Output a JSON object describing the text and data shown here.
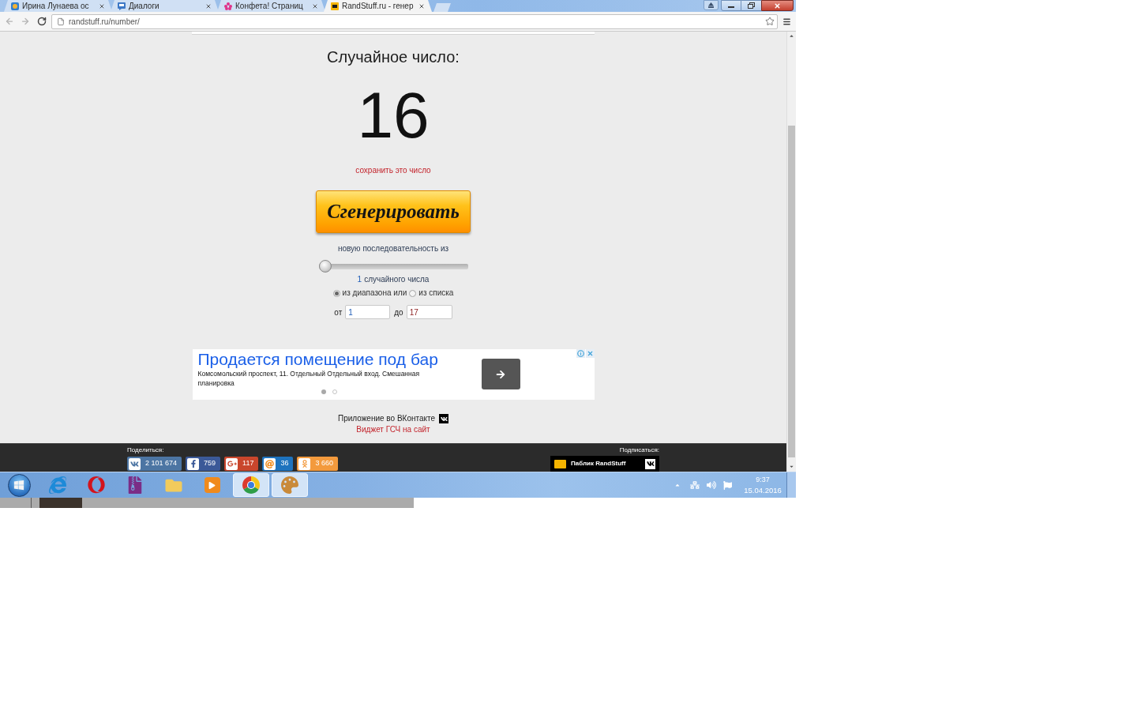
{
  "browser": {
    "tabs": [
      {
        "title": "Ирина Лунаева ос",
        "selected": false
      },
      {
        "title": "Диалоги",
        "selected": false
      },
      {
        "title": "Конфета! Страниц",
        "selected": false
      },
      {
        "title": "RandStuff.ru - генер",
        "selected": true
      }
    ],
    "url": "randstuff.ru/number/"
  },
  "page": {
    "heading": "Случайное число:",
    "number": "16",
    "save_link": "сохранить это число",
    "generate_button": "Сгенерировать",
    "sequence_label": "новую последовательность из",
    "count_slider": {
      "level": 0
    },
    "count": "1",
    "count_label": "случайного числа",
    "source_options": [
      {
        "label": "из диапазона или",
        "selected": true
      },
      {
        "label": "из списка",
        "selected": false
      }
    ],
    "range": {
      "from_label": "от",
      "from_value": "1",
      "to_label": "до",
      "to_value": "17"
    },
    "ad": {
      "title": "Продается помещение под бар",
      "text": "Комсомольский проспект, 11. Отдельный Отдельный вход. Смешанная планировка",
      "slides": [
        {
          "selected": true
        },
        {
          "selected": false
        }
      ]
    },
    "vk_app_label": "Приложение во ВКонтакте",
    "widget_link": "Виджет ГСЧ на сайт"
  },
  "footer": {
    "share_label": "Поделиться:",
    "share_buttons": [
      {
        "count": "2 101 674",
        "color": "#4c75a3"
      },
      {
        "count": "759",
        "color": "#3b5998"
      },
      {
        "count": "117",
        "color": "#c9462c"
      },
      {
        "count": "36",
        "color": "#1e73be"
      },
      {
        "count": "3 660",
        "color": "#f39a3d"
      }
    ],
    "subscribe_label": "Подписаться:",
    "public_button": "Паблик RandStuff"
  },
  "taskbar": {
    "apps": [
      {
        "selected": false
      },
      {
        "selected": false
      },
      {
        "selected": false
      },
      {
        "selected": false
      },
      {
        "selected": false
      },
      {
        "selected": true
      },
      {
        "selected": true
      }
    ],
    "clock": {
      "time": "9:37",
      "date": "15.04.2016"
    }
  }
}
